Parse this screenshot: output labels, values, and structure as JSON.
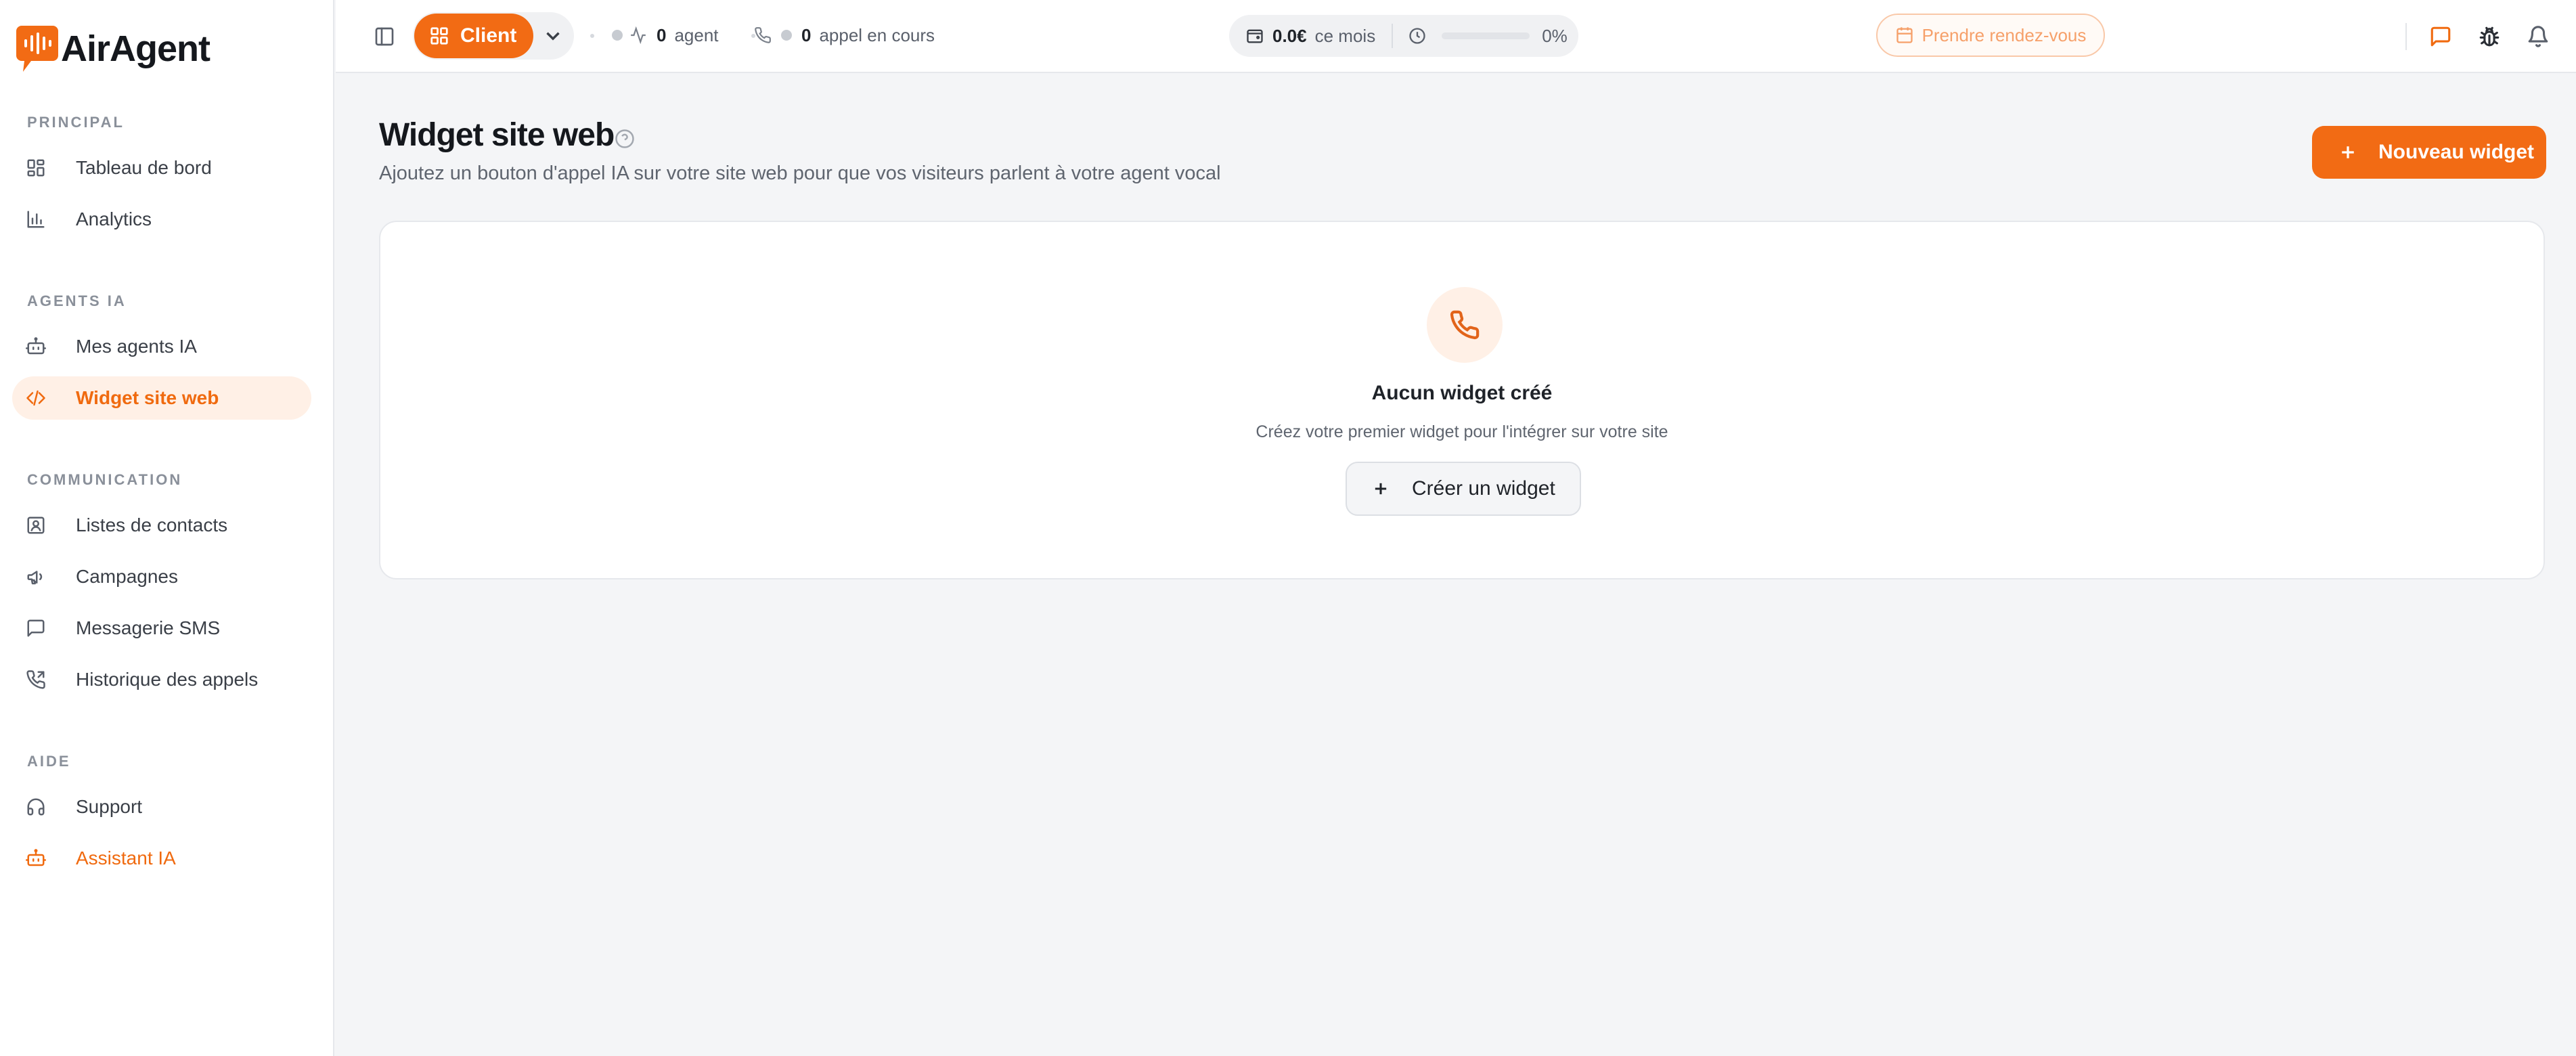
{
  "brand": {
    "name": "AirAgent",
    "accent_color": "#f26b14"
  },
  "sidebar": {
    "sections": [
      {
        "label": "PRINCIPAL"
      },
      {
        "label": "AGENTS IA"
      },
      {
        "label": "COMMUNICATION"
      },
      {
        "label": "AIDE"
      }
    ],
    "items": [
      {
        "label": "Tableau de bord",
        "icon": "dashboard-icon"
      },
      {
        "label": "Analytics",
        "icon": "bar-chart-icon"
      },
      {
        "label": "Mes agents IA",
        "icon": "bot-icon"
      },
      {
        "label": "Widget site web",
        "icon": "code-icon",
        "active": true
      },
      {
        "label": "Listes de contacts",
        "icon": "contact-icon"
      },
      {
        "label": "Campagnes",
        "icon": "megaphone-icon"
      },
      {
        "label": "Messagerie SMS",
        "icon": "message-icon"
      },
      {
        "label": "Historique des appels",
        "icon": "phone-history-icon"
      },
      {
        "label": "Support",
        "icon": "headphones-icon"
      },
      {
        "label": "Assistant IA",
        "icon": "bot-icon"
      }
    ]
  },
  "topbar": {
    "role": "Client",
    "agents": {
      "count": "0",
      "label": "agent"
    },
    "calls": {
      "count": "0",
      "label": "appel en cours"
    },
    "usage": {
      "amount": "0.0€",
      "period": "ce mois",
      "percent_label": "0%",
      "progress": 0
    },
    "appointment_label": "Prendre rendez-vous"
  },
  "main": {
    "title": "Widget site web",
    "subtitle": "Ajoutez un bouton d'appel IA sur votre site web pour que vos visiteurs parlent à votre agent vocal",
    "new_button": "Nouveau widget",
    "empty": {
      "title": "Aucun widget créé",
      "description": "Créez votre premier widget pour l'intégrer sur votre site",
      "button": "Créer un widget"
    }
  }
}
